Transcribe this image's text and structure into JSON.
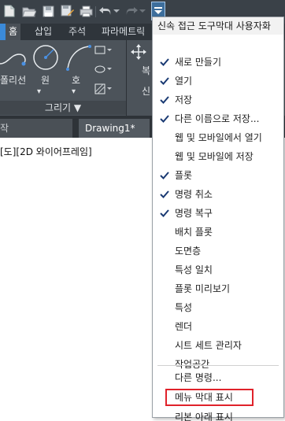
{
  "colors": {
    "accent": "#3d6e9c",
    "highlight_border": "#e0222a",
    "ribbon": "#4c535a"
  },
  "qat": {
    "icons": [
      "new-icon",
      "open-icon",
      "save-icon",
      "save-as-icon",
      "print-icon",
      "undo-icon",
      "redo-icon",
      "customize-dropdown-icon"
    ]
  },
  "ribbon": {
    "tabs": [
      "홈",
      "삽입",
      "주석",
      "파라메트릭"
    ],
    "active_tab": "홈",
    "tools": {
      "polyline": "폴리선",
      "circle": "원",
      "arc": "호"
    },
    "panel_label": "그리기 ▼",
    "clipped_tools": {
      "t1": "복",
      "t2": "신"
    }
  },
  "file_tabs": {
    "partial": "작",
    "drawing": "Drawing1*"
  },
  "viewport": {
    "label": "[도][2D 와이어프레임]"
  },
  "menu": {
    "header": "신속 접근 도구막대 사용자화",
    "items": [
      {
        "label": "새로 만들기",
        "checked": true
      },
      {
        "label": "열기",
        "checked": true
      },
      {
        "label": "저장",
        "checked": true
      },
      {
        "label": "다른 이름으로 저장...",
        "checked": true
      },
      {
        "label": "웹 및 모바일에서 열기",
        "checked": false
      },
      {
        "label": "웹 및 모바일에 저장",
        "checked": false
      },
      {
        "label": "플롯",
        "checked": true
      },
      {
        "label": "명령 취소",
        "checked": true
      },
      {
        "label": "명령 복구",
        "checked": true
      },
      {
        "label": "배치 플롯",
        "checked": false
      },
      {
        "label": "도면층",
        "checked": false
      },
      {
        "label": "특성 일치",
        "checked": false
      },
      {
        "label": "플롯 미리보기",
        "checked": false
      },
      {
        "label": "특성",
        "checked": false
      },
      {
        "label": "렌더",
        "checked": false
      },
      {
        "label": "시트 세트 관리자",
        "checked": false
      },
      {
        "label": "작업공간",
        "checked": false
      }
    ],
    "more_commands": "다른 명령...",
    "show_menu_bar": "메뉴 막대 표시",
    "show_below_ribbon": "리본 아래 표시"
  }
}
